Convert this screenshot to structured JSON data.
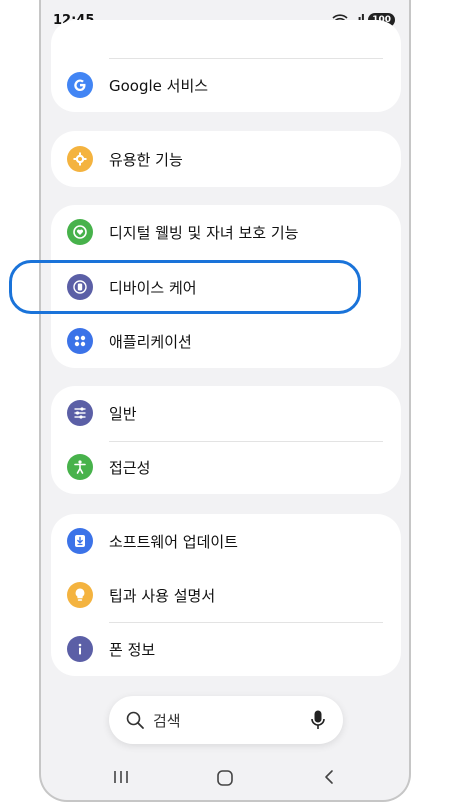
{
  "status_bar": {
    "time": "12:45",
    "battery": "100",
    "wifi_icon": "wifi-icon",
    "signal_icon": "signal-icon"
  },
  "groups": [
    {
      "items": [
        {
          "label": "Google 서비스",
          "icon": "google-icon",
          "color": "#4285f4"
        }
      ]
    },
    {
      "items": [
        {
          "label": "유용한 기능",
          "icon": "gear-star-icon",
          "color": "#f4b33f"
        }
      ]
    },
    {
      "items": [
        {
          "label": "디지털 웰빙 및 자녀 보호 기능",
          "icon": "heart-wellbeing-icon",
          "color": "#47b24b"
        },
        {
          "label": "디바이스 케어",
          "icon": "device-care-icon",
          "color": "#5b5fa6"
        },
        {
          "label": "애플리케이션",
          "icon": "apps-grid-icon",
          "color": "#3c73e8"
        }
      ]
    },
    {
      "items": [
        {
          "label": "일반",
          "icon": "sliders-icon",
          "color": "#5b5fa6"
        },
        {
          "label": "접근성",
          "icon": "accessibility-icon",
          "color": "#47b24b"
        }
      ]
    },
    {
      "items": [
        {
          "label": "소프트웨어 업데이트",
          "icon": "download-icon",
          "color": "#3c73e8"
        },
        {
          "label": "팁과 사용 설명서",
          "icon": "lightbulb-icon",
          "color": "#f4b33f"
        },
        {
          "label": "폰 정보",
          "icon": "info-icon",
          "color": "#5b5fa6"
        }
      ]
    }
  ],
  "highlight_color": "#1a73d9",
  "search": {
    "placeholder": "검색",
    "icon": "search-icon",
    "mic_icon": "microphone-icon"
  },
  "nav": {
    "recents_icon": "recents-icon",
    "home_icon": "home-icon",
    "back_icon": "back-icon"
  }
}
